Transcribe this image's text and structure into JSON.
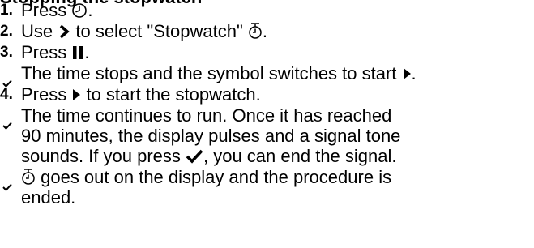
{
  "section": {
    "heading": "Stopping the stopwatch"
  },
  "steps": [
    {
      "kind": "numbered",
      "number": "1.",
      "parts": [
        "Press ",
        "."
      ],
      "icons": [
        "clock-icon"
      ]
    },
    {
      "kind": "numbered",
      "number": "2.",
      "parts": [
        "Use ",
        " to select \"Stopwatch\" ",
        "."
      ],
      "icons": [
        "chevron-right-icon",
        "stopwatch-icon"
      ]
    },
    {
      "kind": "numbered",
      "number": "3.",
      "parts": [
        "Press ",
        "."
      ],
      "icons": [
        "pause-icon"
      ]
    },
    {
      "kind": "result",
      "parts": [
        "The time stops and the symbol switches to start ",
        "."
      ],
      "icons": [
        "play-icon"
      ]
    },
    {
      "kind": "numbered",
      "number": "4.",
      "parts": [
        "Press ",
        " to start the stopwatch."
      ],
      "icons": [
        "play-icon"
      ]
    },
    {
      "kind": "result",
      "lines": [
        "The time continues to run. Once it has reached",
        "90 minutes, the display pulses and a signal tone",
        "sounds. If you press "
      ],
      "tail": ", you can end the signal.",
      "icons": [
        "checkmark-icon"
      ]
    },
    {
      "kind": "result",
      "lines": [
        " goes out on the display and the procedure is",
        "ended."
      ],
      "icons": [
        "stopwatch-icon"
      ]
    }
  ],
  "colors": {
    "text": "#000000"
  }
}
